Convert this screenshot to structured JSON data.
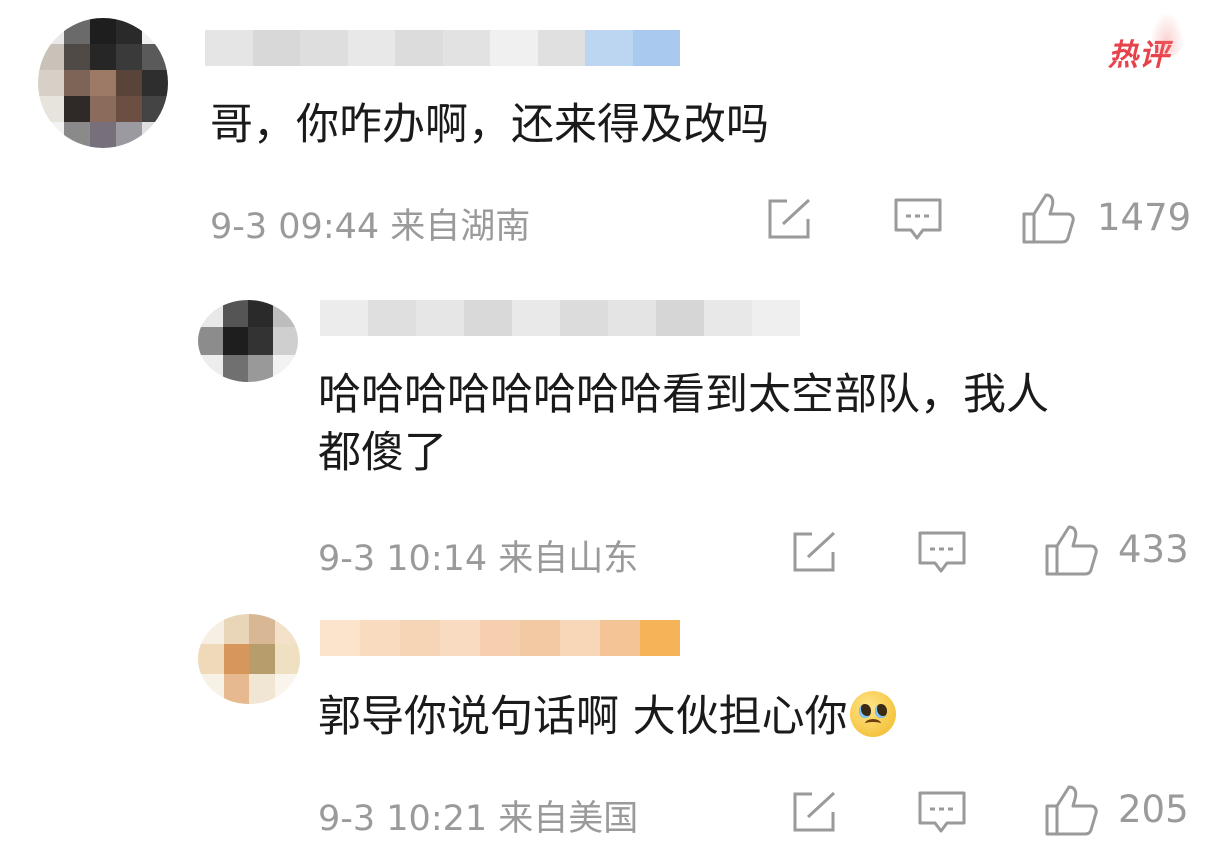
{
  "comments": [
    {
      "text": "哥，你咋办啊，还来得及改吗",
      "time": "9-3 09:44",
      "location": "来自湖南",
      "likes": "1479",
      "badge": "热评"
    },
    {
      "text_line1": "哈哈哈哈哈哈哈哈看到太空部队，我人",
      "text_line2": "都傻了",
      "time": "9-3 10:14",
      "location": "来自山东",
      "likes": "433"
    },
    {
      "text": "郭导你说句话啊 大伙担心你",
      "time": "9-3 10:21",
      "location": "来自美国",
      "likes": "205"
    }
  ],
  "icons": {
    "share": "share-icon",
    "reply": "comment-icon",
    "like": "thumbs-up-icon",
    "emoji": "pleading-face-emoji"
  },
  "colors": {
    "text": "#1a1a1a",
    "meta": "#9a9a9a",
    "badge": "#e8434c"
  }
}
